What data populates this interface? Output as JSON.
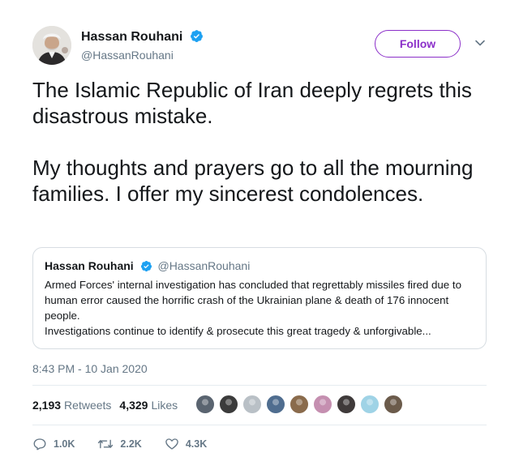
{
  "author": {
    "name": "Hassan Rouhani",
    "handle": "@HassanRouhani",
    "verified": true
  },
  "follow_label": "Follow",
  "tweet_text": "The Islamic Republic of Iran deeply regrets this disastrous mistake.\n\nMy thoughts and prayers go to all the mourning families. I offer my sincerest condolences.",
  "quoted": {
    "name": "Hassan Rouhani",
    "handle": "@HassanRouhani",
    "text": "Armed Forces' internal investigation has concluded that regrettably missiles fired due to human error caused the horrific crash of the Ukrainian plane & death of 176 innocent people.\nInvestigations continue to identify & prosecute this great tragedy & unforgivable..."
  },
  "timestamp": "8:43 PM - 10 Jan 2020",
  "stats": {
    "retweets_count": "2,193",
    "retweets_label": "Retweets",
    "likes_count": "4,329",
    "likes_label": "Likes"
  },
  "likers_avatar_colors": [
    "#5a6470",
    "#3b3b3b",
    "#b9c0c6",
    "#4f6d8f",
    "#8a6b4c",
    "#c58fb0",
    "#3f3a3a",
    "#9fd3e6",
    "#6b5b4b"
  ],
  "actions": {
    "replies": "1.0K",
    "retweets": "2.2K",
    "likes": "4.3K"
  },
  "colors": {
    "accent": "#8b2fc9",
    "verified": "#1da1f2",
    "muted": "#657786"
  }
}
